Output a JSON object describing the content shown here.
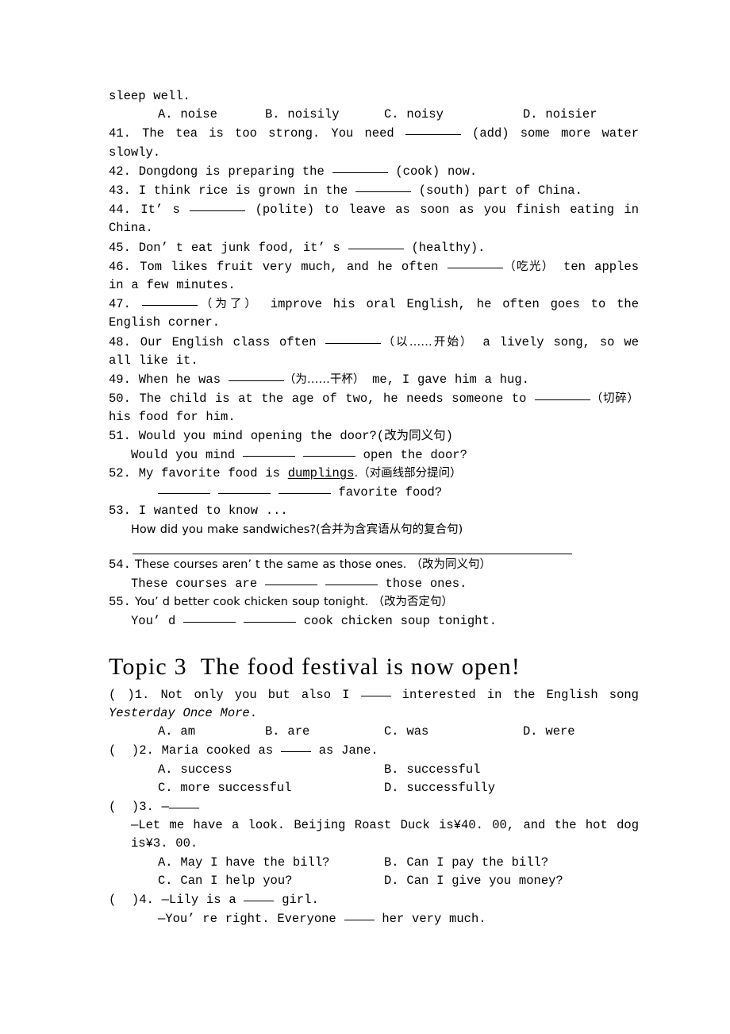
{
  "document": {
    "type": "english-exercise-worksheet",
    "language": "en-zh"
  },
  "carryover_line": "sleep well.",
  "carryover_options": {
    "a": "A. noise",
    "b": "B. noisily",
    "c": "C. noisy",
    "d": "D. noisier"
  },
  "fill_in_section": {
    "items": [
      {
        "number": "41.",
        "pre": " The tea is too strong. You need ",
        "post": " (add) some more water slowly."
      },
      {
        "number": "42.",
        "pre": " Dongdong is preparing the ",
        "post": " (cook) now."
      },
      {
        "number": "43.",
        "pre": " I think rice is grown in the ",
        "post": " (south) part of China."
      },
      {
        "number": "44.",
        "pre": " It’ s ",
        "post": " (polite) to leave as soon as you finish eating in China."
      },
      {
        "number": "45.",
        "pre": " Don’ t eat junk food, it’ s ",
        "post": " (healthy)."
      },
      {
        "number": "46.",
        "pre": " Tom likes fruit very much, and he often ",
        "hint": "（吃光）",
        "post": " ten apples in a few minutes."
      },
      {
        "number": "47.",
        "pre": " ",
        "hint": "（为了）",
        "post": " improve his oral English, he often goes to the English corner."
      },
      {
        "number": "48.",
        "pre": " Our English class often ",
        "hint": "（以……开始）",
        "post": " a lively song, so we all like it."
      },
      {
        "number": "49.",
        "pre": " When he was ",
        "hint": "（为……干杯）",
        "post": " me, I gave him a hug."
      },
      {
        "number": "50.",
        "pre": " The child is at the age of two, he needs someone to ",
        "hint": "（切碎）",
        "post": " his food for him."
      }
    ]
  },
  "transform_section": {
    "q51": {
      "prompt_num": "51.",
      "prompt": " Would you mind opening the door?(改为同义句)",
      "answer_pre": "Would you mind ",
      "answer_post": " open the door?"
    },
    "q52": {
      "prompt_num": "52.",
      "prompt_a": " My favorite food is ",
      "prompt_underlined": "dumplings",
      "prompt_b": ".（对画线部分提问）",
      "answer_post": " favorite food?"
    },
    "q53": {
      "prompt_num": "53.",
      "prompt": " I wanted to know ...",
      "line2": "How did you make sandwiches?(合并为含宾语从句的复合句)"
    },
    "q54": {
      "prompt_num": "54.",
      "prompt": " These courses aren’ t the same as those ones. （改为同义句）",
      "answer_pre": "These courses are ",
      "answer_post": " those ones."
    },
    "q55": {
      "prompt_num": "55.",
      "prompt": " You’ d better cook chicken soup tonight. （改为否定句）",
      "answer_pre": "You’ d ",
      "answer_post": " cook chicken soup tonight."
    }
  },
  "topic_heading": "Topic 3  The food festival is now open!",
  "choice_section": {
    "q1": {
      "marker": "(  )1.",
      "stem_a": " Not only you but also I ",
      "stem_b": " interested in the English song ",
      "italic_title": "Yesterday Once More",
      "stem_c": ".",
      "options": [
        "A. am",
        "B. are",
        "C. was",
        "D. were"
      ]
    },
    "q2": {
      "marker": "(  )2.",
      "stem_a": " Maria cooked as ",
      "stem_b": " as Jane.",
      "options": [
        "A. success",
        "B. successful",
        "C. more successful",
        "D. successfully"
      ]
    },
    "q3": {
      "marker": "(  )3.",
      "stem_a": " —",
      "line2": "—Let me have a look. Beijing Roast Duck is¥40. 00, and the hot dog is¥3. 00.",
      "options": [
        "A. May I have the bill?",
        "B. Can I pay the bill?",
        "C. Can I help you?",
        "D. Can I give you money?"
      ]
    },
    "q4": {
      "marker": "(  )4.",
      "stem_a": " —Lily is a ",
      "stem_b": " girl.",
      "line2_a": "—You’ re right. Everyone ",
      "line2_b": " her very much."
    }
  },
  "colors": {
    "text": "#000000",
    "page_background": "#ffffff"
  }
}
